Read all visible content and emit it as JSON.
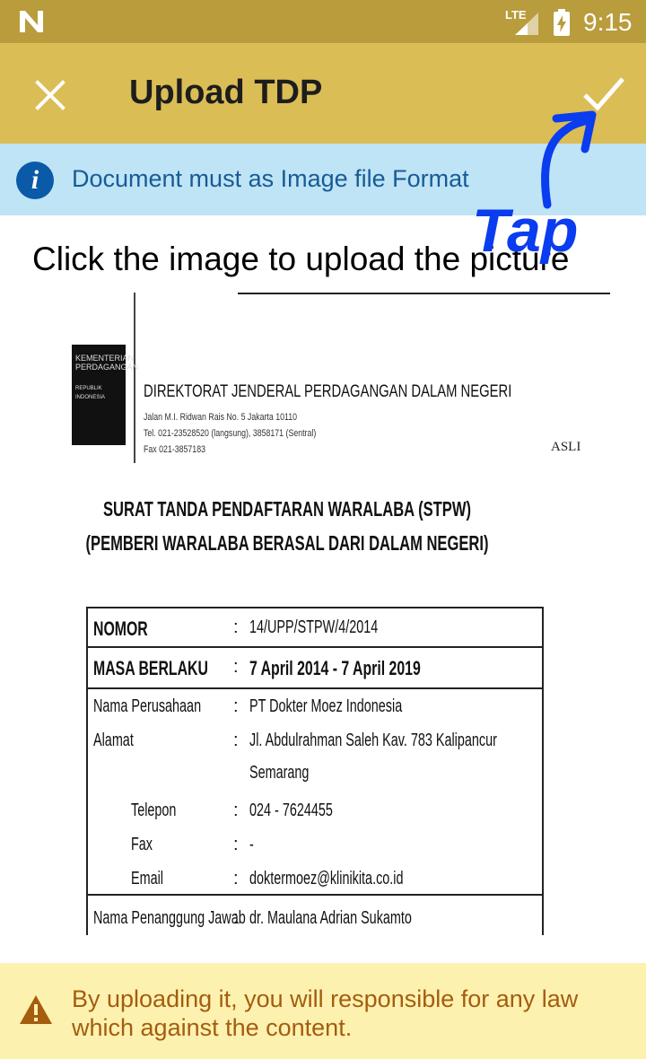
{
  "status_bar": {
    "network": "LTE",
    "time": "9:15"
  },
  "app_bar": {
    "title": "Upload TDP"
  },
  "info_banner": {
    "text": "Document must as Image file Format"
  },
  "instruction": "Click the image to upload the picture",
  "annotation": {
    "text": "Tap"
  },
  "document": {
    "logo_lines": [
      "KEMENTERIAN",
      "PERDAGANGAN",
      "REPUBLIK INDONESIA"
    ],
    "org_name": "DIREKTORAT JENDERAL PERDAGANGAN DALAM NEGERI",
    "address_lines": [
      "Jalan M.I. Ridwan Rais No. 5 Jakarta 10110",
      "Tel. 021-23528520 (langsung), 3858171 (Sentral)",
      "Fax 021-3857183"
    ],
    "stamp": "ASLI",
    "title_line1": "SURAT TANDA PENDAFTARAN WARALABA (STPW)",
    "title_line2": "(PEMBERI WARALABA BERASAL DARI DALAM NEGERI)",
    "rows": {
      "nomor_label": "NOMOR",
      "nomor_value": "14/UPP/STPW/4/2014",
      "masa_label": "MASA BERLAKU",
      "masa_value": "7 April 2014 - 7 April 2019",
      "nama_label": "Nama Perusahaan",
      "nama_value": "PT Dokter Moez Indonesia",
      "alamat_label": "Alamat",
      "alamat_value1": "Jl. Abdulrahman Saleh Kav. 783 Kalipancur",
      "alamat_value2": "Semarang",
      "telepon_label": "Telepon",
      "telepon_value": "024 - 7624455",
      "fax_label": "Fax",
      "fax_value": "-",
      "email_label": "Email",
      "email_value": "doktermoez@klinikita.co.id",
      "pj_label": "Nama Penanggung Jawab",
      "pj_value": "dr. Maulana Adrian Sukamto",
      "separator": ":"
    }
  },
  "warning_banner": {
    "text": "By uploading it, you will responsible for any law which against the content."
  },
  "colors": {
    "status_bar": "#b99c3c",
    "app_bar": "#dbbd55",
    "info_bg": "#bfe4f5",
    "info_text": "#175b96",
    "warn_bg": "#fdf1b0",
    "warn_text": "#a45d0f",
    "annotation": "#0a3cf0"
  }
}
